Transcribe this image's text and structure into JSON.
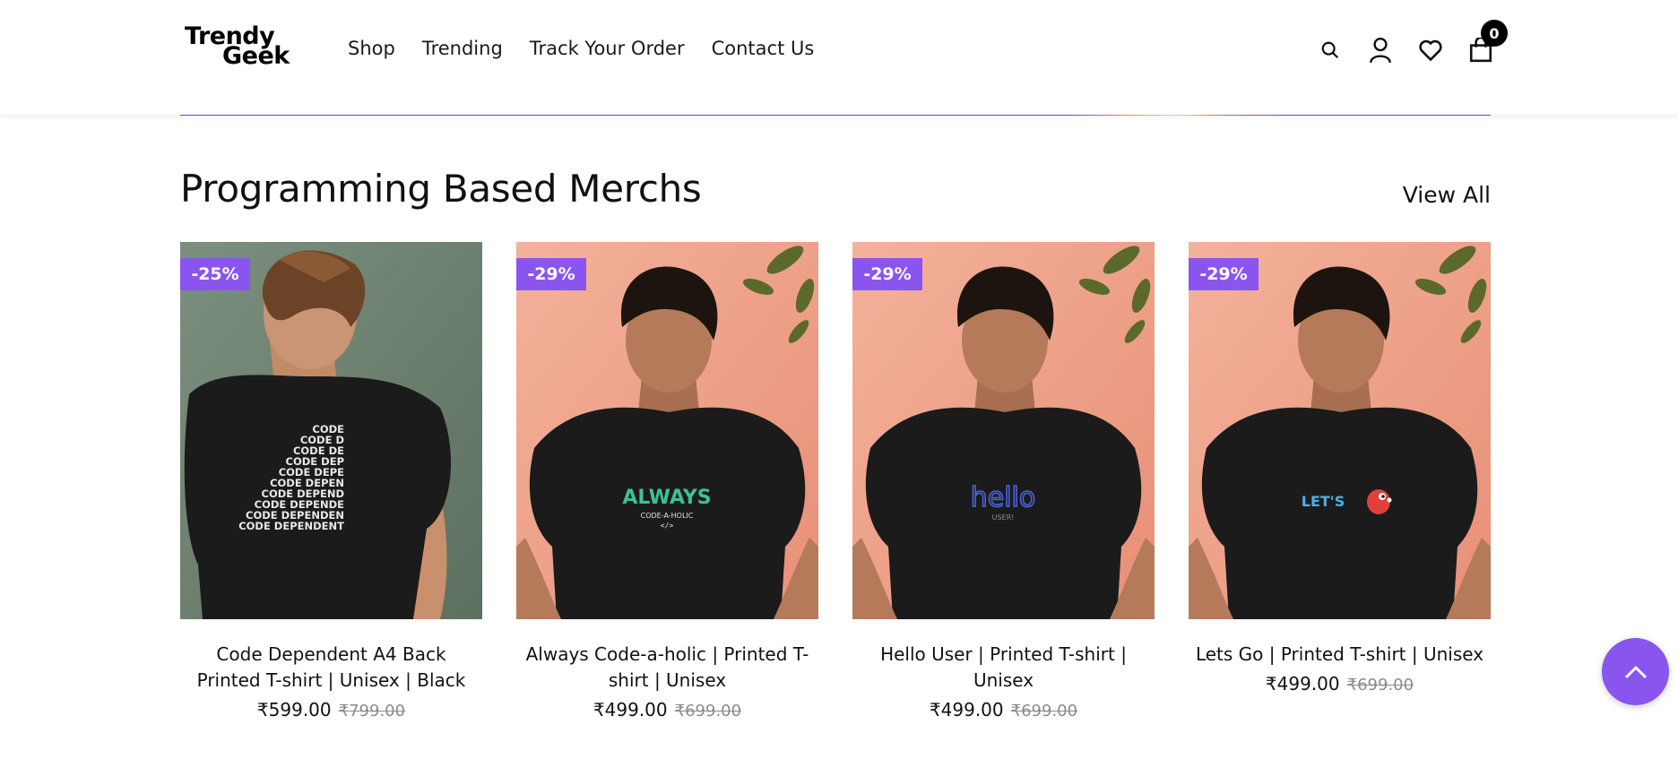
{
  "header": {
    "logo_line1": "Trendy",
    "logo_line2": "Geek",
    "nav": [
      "Shop",
      "Trending",
      "Track Your Order",
      "Contact Us"
    ],
    "cart_count": "0",
    "icons": [
      "search-icon",
      "user-icon",
      "heart-icon",
      "cart-icon"
    ]
  },
  "section": {
    "title": "Programming Based Merchs",
    "view_all": "View All"
  },
  "products": [
    {
      "badge": "-25%",
      "name": "Code Dependent A4 Back Printed T-shirt | Unisex | Black",
      "price": "₹599.00",
      "old_price": "₹799.00"
    },
    {
      "badge": "-29%",
      "name": "Always Code-a-holic | Printed T-shirt | Unisex",
      "price": "₹499.00",
      "old_price": "₹699.00"
    },
    {
      "badge": "-29%",
      "name": "Hello User | Printed T-shirt | Unisex",
      "price": "₹499.00",
      "old_price": "₹699.00"
    },
    {
      "badge": "-29%",
      "name": "Lets Go | Printed T-shirt | Unisex",
      "price": "₹499.00",
      "old_price": "₹699.00"
    }
  ],
  "shirt_prints": {
    "p1_lines": [
      "CODE",
      "CODE D",
      "CODE DE",
      "CODE DEP",
      "CODE DEPE",
      "CODE DEPEN",
      "CODE DEPEND",
      "CODE DEPENDE",
      "CODE DEPENDEN",
      "CODE DEPENDENT"
    ],
    "p2_big": "ALWAYS",
    "p2_small": "CODE-A-HOLIC",
    "p2_code": "</>",
    "p3_big": "hello",
    "p3_small": "USER!",
    "p4_text": "LET'S"
  },
  "colors": {
    "accent": "#8a55ef",
    "peach_bg": "#efa48c",
    "sage_bg": "#6e8270",
    "shirt": "#1b1b1b"
  }
}
